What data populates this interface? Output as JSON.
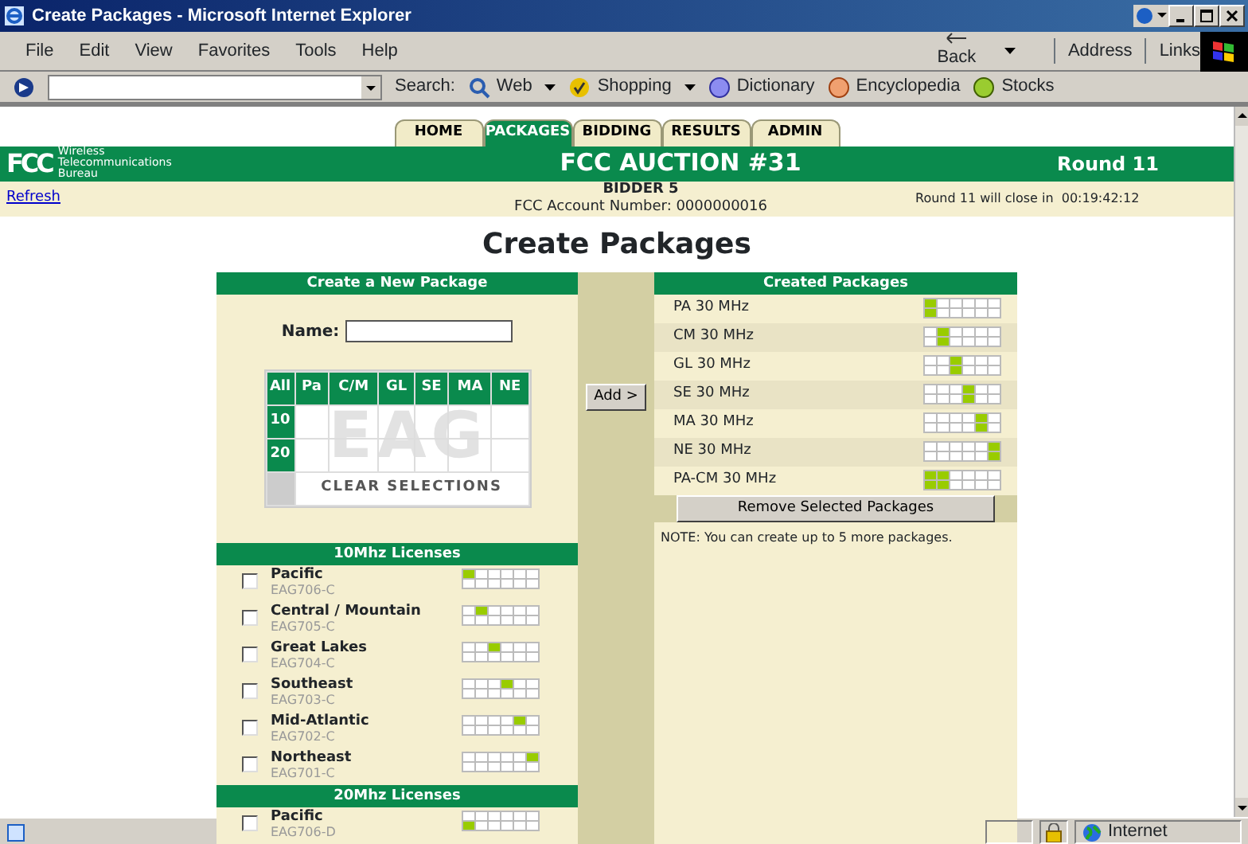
{
  "window": {
    "title": "Create Packages - Microsoft Internet Explorer"
  },
  "menu": [
    "File",
    "Edit",
    "View",
    "Favorites",
    "Tools",
    "Help"
  ],
  "nav_buttons": {
    "back": "Back"
  },
  "address_label": "Address",
  "links_label": "Links",
  "search_bar": {
    "label": "Search:",
    "items": [
      {
        "kind": "search",
        "label": "Web",
        "dropdown": true
      },
      {
        "kind": "check",
        "label": "Shopping",
        "dropdown": true
      },
      {
        "kind": "d",
        "label": "Dictionary",
        "dropdown": false
      },
      {
        "kind": "e",
        "label": "Encyclopedia",
        "dropdown": false
      },
      {
        "kind": "dollar",
        "label": "Stocks",
        "dropdown": false
      }
    ]
  },
  "site_tabs": [
    {
      "label": "HOME",
      "selected": false
    },
    {
      "label": "PACKAGES",
      "selected": true
    },
    {
      "label": "BIDDING",
      "selected": false
    },
    {
      "label": "RESULTS",
      "selected": false
    },
    {
      "label": "ADMIN",
      "selected": false
    }
  ],
  "header": {
    "logo": "FCC",
    "bureau": [
      "Wireless",
      "Telecommunications",
      "Bureau"
    ],
    "title": "FCC AUCTION #31",
    "round": "Round 11"
  },
  "info": {
    "refresh": "Refresh",
    "bidder": "BIDDER 5",
    "account": "FCC Account Number: 0000000016",
    "closing": "Round 11 will close in  00:19:42:12"
  },
  "page_title": "Create Packages",
  "new_package": {
    "title": "Create a New Package",
    "name_label": "Name:",
    "grid": {
      "columns": [
        "All",
        "Pa",
        "C/M",
        "GL",
        "SE",
        "MA",
        "NE"
      ],
      "rows": [
        "10",
        "20"
      ],
      "background_text": "EAG",
      "clear": "CLEAR SELECTIONS"
    }
  },
  "add_button": "Add >",
  "license_groups": [
    {
      "title": "10Mhz Licenses",
      "licenses": [
        {
          "name": "Pacific",
          "code": "EAG706-C",
          "checked": false,
          "cells": [
            [
              true,
              false,
              false,
              false,
              false,
              false
            ],
            [
              false,
              false,
              false,
              false,
              false,
              false
            ]
          ]
        },
        {
          "name": "Central / Mountain",
          "code": "EAG705-C",
          "checked": false,
          "cells": [
            [
              false,
              true,
              false,
              false,
              false,
              false
            ],
            [
              false,
              false,
              false,
              false,
              false,
              false
            ]
          ]
        },
        {
          "name": "Great Lakes",
          "code": "EAG704-C",
          "checked": false,
          "cells": [
            [
              false,
              false,
              true,
              false,
              false,
              false
            ],
            [
              false,
              false,
              false,
              false,
              false,
              false
            ]
          ]
        },
        {
          "name": "Southeast",
          "code": "EAG703-C",
          "checked": false,
          "cells": [
            [
              false,
              false,
              false,
              true,
              false,
              false
            ],
            [
              false,
              false,
              false,
              false,
              false,
              false
            ]
          ]
        },
        {
          "name": "Mid-Atlantic",
          "code": "EAG702-C",
          "checked": false,
          "cells": [
            [
              false,
              false,
              false,
              false,
              true,
              false
            ],
            [
              false,
              false,
              false,
              false,
              false,
              false
            ]
          ]
        },
        {
          "name": "Northeast",
          "code": "EAG701-C",
          "checked": false,
          "cells": [
            [
              false,
              false,
              false,
              false,
              false,
              true
            ],
            [
              false,
              false,
              false,
              false,
              false,
              false
            ]
          ]
        }
      ]
    },
    {
      "title": "20Mhz Licenses",
      "licenses": [
        {
          "name": "Pacific",
          "code": "EAG706-D",
          "checked": false,
          "cells": [
            [
              false,
              false,
              false,
              false,
              false,
              false
            ],
            [
              true,
              false,
              false,
              false,
              false,
              false
            ]
          ]
        }
      ]
    }
  ],
  "created_packages": {
    "title": "Created Packages",
    "packages": [
      {
        "name": "PA 30 MHz",
        "cells": [
          [
            true,
            false,
            false,
            false,
            false,
            false
          ],
          [
            true,
            false,
            false,
            false,
            false,
            false
          ]
        ]
      },
      {
        "name": "CM 30 MHz",
        "cells": [
          [
            false,
            true,
            false,
            false,
            false,
            false
          ],
          [
            false,
            true,
            false,
            false,
            false,
            false
          ]
        ]
      },
      {
        "name": "GL 30 MHz",
        "cells": [
          [
            false,
            false,
            true,
            false,
            false,
            false
          ],
          [
            false,
            false,
            true,
            false,
            false,
            false
          ]
        ]
      },
      {
        "name": "SE 30 MHz",
        "cells": [
          [
            false,
            false,
            false,
            true,
            false,
            false
          ],
          [
            false,
            false,
            false,
            true,
            false,
            false
          ]
        ]
      },
      {
        "name": "MA 30 MHz",
        "cells": [
          [
            false,
            false,
            false,
            false,
            true,
            false
          ],
          [
            false,
            false,
            false,
            false,
            true,
            false
          ]
        ]
      },
      {
        "name": "NE 30 MHz",
        "cells": [
          [
            false,
            false,
            false,
            false,
            false,
            true
          ],
          [
            false,
            false,
            false,
            false,
            false,
            true
          ]
        ]
      },
      {
        "name": "PA-CM 30 MHz",
        "cells": [
          [
            true,
            true,
            false,
            false,
            false,
            false
          ],
          [
            true,
            true,
            false,
            false,
            false,
            false
          ]
        ]
      }
    ],
    "remove_button": "Remove Selected Packages",
    "note": "NOTE: You can create up to 5 more packages."
  },
  "status_bar": {
    "zone": "Internet"
  }
}
